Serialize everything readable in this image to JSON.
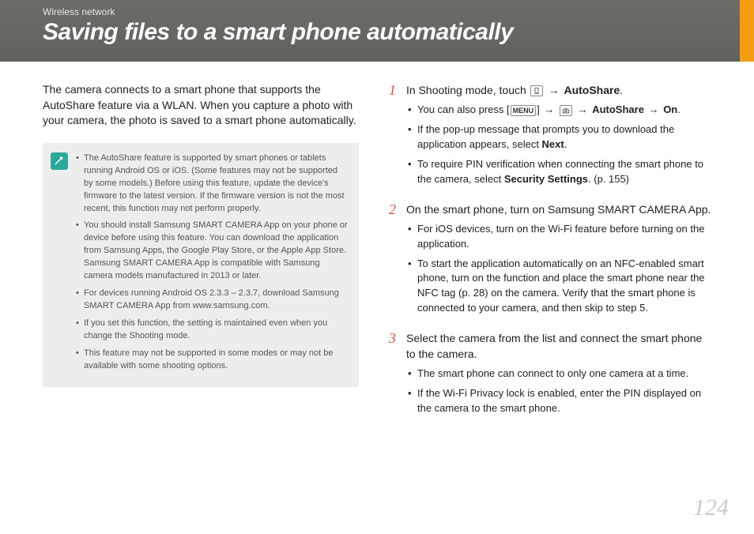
{
  "header": {
    "breadcrumb": "Wireless network",
    "title": "Saving files to a smart phone automatically"
  },
  "intro": "The camera connects to a smart phone that supports the AutoShare feature via a WLAN. When you capture a photo with your camera, the photo is saved to a smart phone automatically.",
  "notes": [
    "The AutoShare feature is supported by smart phones or tablets running Android OS or iOS. (Some features may not be supported by some models.) Before using this feature, update the device's firmware to the latest version. If the firmware version is not the most recent, this function may not perform properly.",
    "You should install Samsung SMART CAMERA App on your phone or device before using this feature. You can download the application from Samsung Apps, the Google Play Store, or the Apple App Store. Samsung SMART CAMERA App is compatible with Samsung camera models manufactured in 2013 or later.",
    "For devices running Android OS 2.3.3 – 2.3.7, download Samsung SMART CAMERA App from www.samsung.com.",
    "If you set this function, the setting is maintained even when you change the Shooting mode.",
    "This feature may not be supported in some modes or may not be available with some shooting options."
  ],
  "steps": {
    "s1": {
      "num": "1",
      "pre": "In Shooting mode, touch ",
      "autoshare": "AutoShare",
      "post": ".",
      "sub1_pre": "You can also press [",
      "sub1_menu": "MENU",
      "sub1_mid": "] ",
      "sub1_autoshare": "AutoShare",
      "sub1_on": "On",
      "sub1_post": ".",
      "sub2_a": "If the pop-up message that prompts you to download the application appears, select ",
      "sub2_b": "Next",
      "sub2_c": ".",
      "sub3_a": "To require PIN verification when connecting the smart phone to the camera, select ",
      "sub3_b": "Security Settings",
      "sub3_c": ". (p. 155)",
      "arrow": "→"
    },
    "s2": {
      "num": "2",
      "main": "On the smart phone, turn on Samsung SMART CAMERA App.",
      "sub1": "For iOS devices, turn on the Wi-Fi feature before turning on the application.",
      "sub2": "To start the application automatically on an NFC-enabled smart phone, turn on the function and place the smart phone near the NFC tag (p. 28) on the camera. Verify that the smart phone is connected to your camera, and then skip to step 5."
    },
    "s3": {
      "num": "3",
      "main": "Select the camera from the list and connect the smart phone to the camera.",
      "sub1": "The smart phone can connect to only one camera at a time.",
      "sub2": "If the Wi-Fi Privacy lock is enabled, enter the PIN displayed on the camera to the smart phone."
    }
  },
  "page_number": "124"
}
